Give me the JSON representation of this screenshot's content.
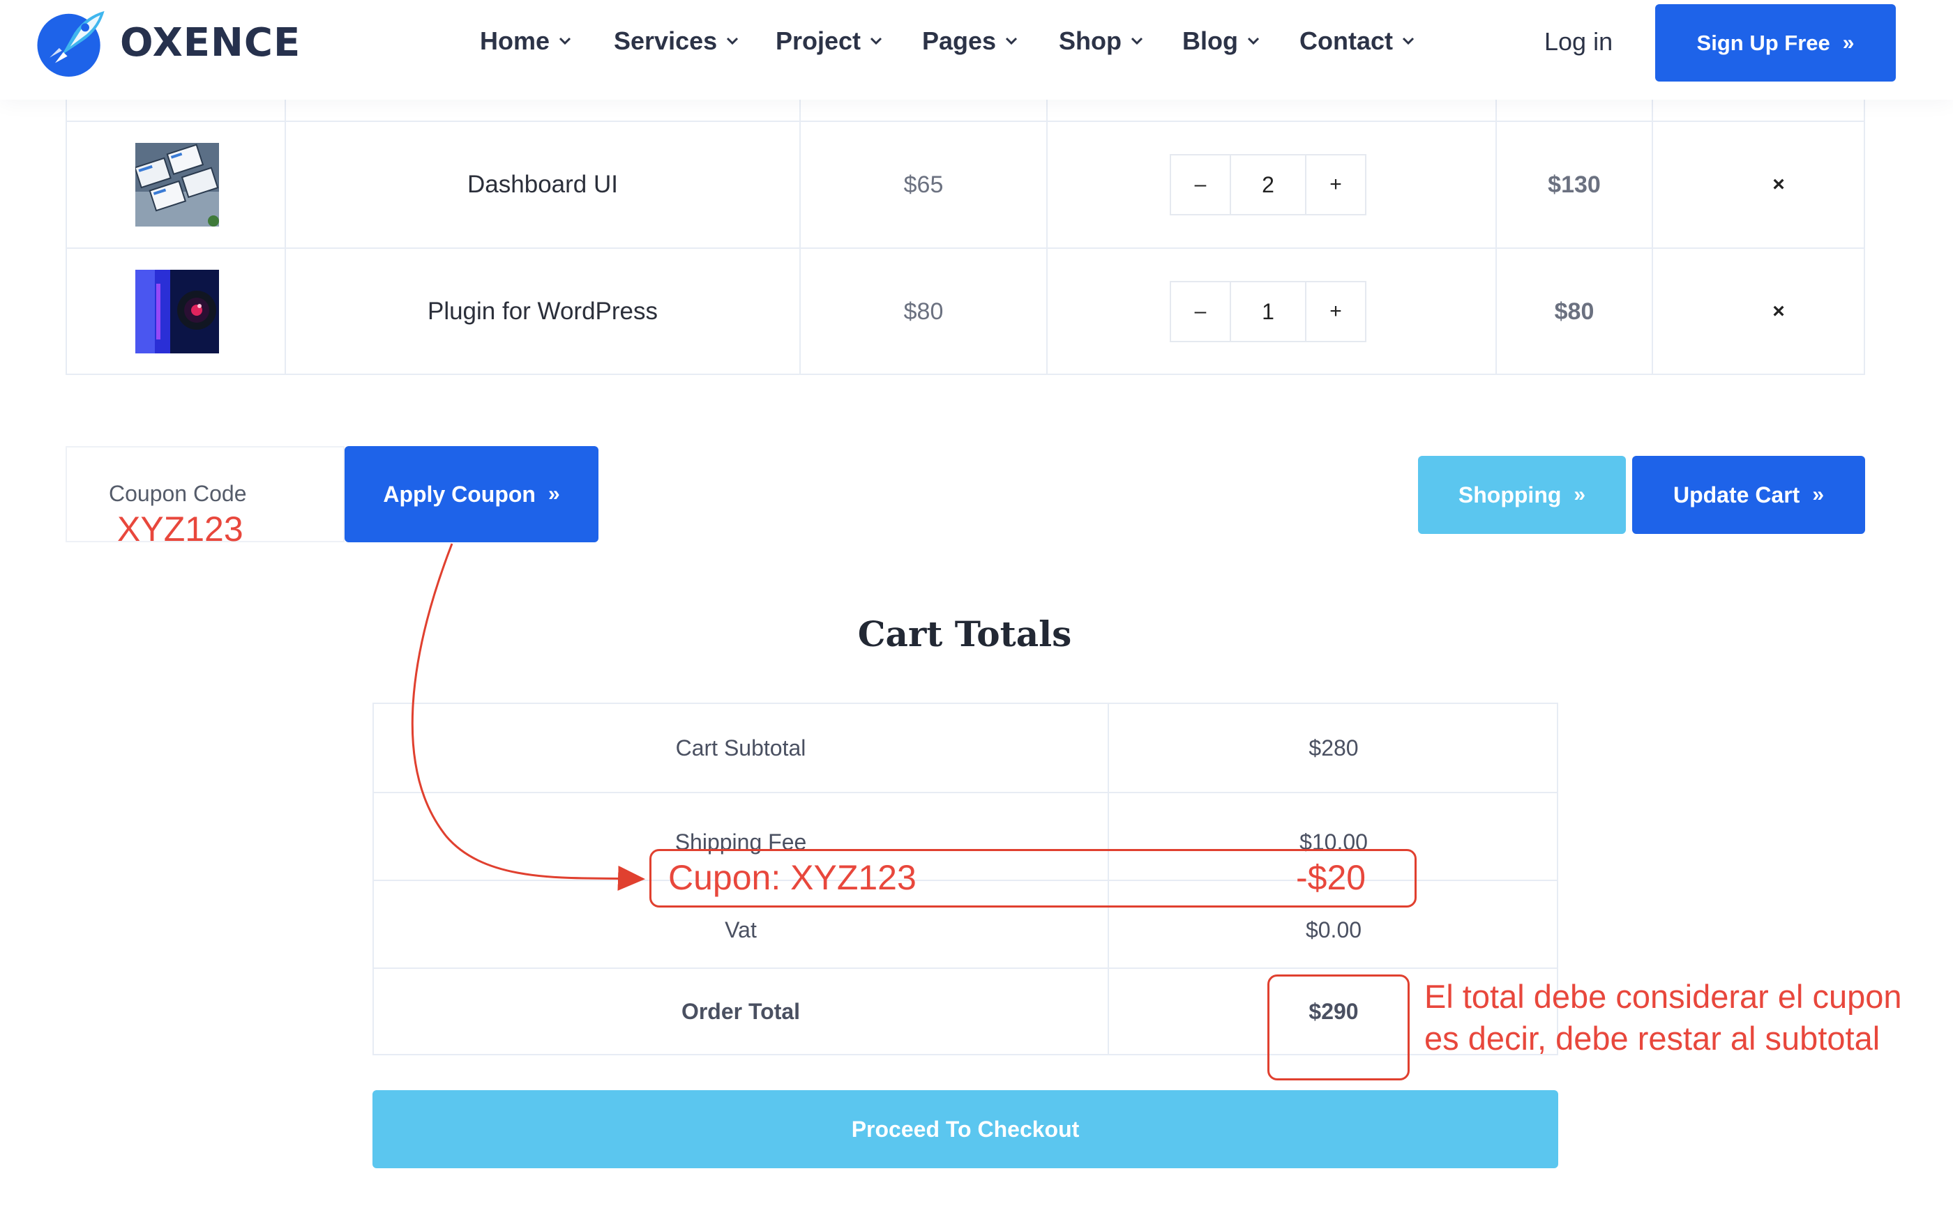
{
  "brand": {
    "name": "OXENCE"
  },
  "nav": {
    "items": [
      {
        "label": "Home"
      },
      {
        "label": "Services"
      },
      {
        "label": "Project"
      },
      {
        "label": "Pages"
      },
      {
        "label": "Shop"
      },
      {
        "label": "Blog"
      },
      {
        "label": "Contact"
      }
    ],
    "login_label": "Log in",
    "signup_label": "Sign Up Free",
    "signup_icon": "double-chevron-right-icon"
  },
  "cart": {
    "rows": [
      {
        "product": "Dashboard UI",
        "price": "$65",
        "quantity": "2",
        "subtotal": "$130",
        "remove": "×",
        "thumb": "dashboard-thumbnail"
      },
      {
        "product": "Plugin for WordPress",
        "price": "$80",
        "quantity": "1",
        "subtotal": "$80",
        "remove": "×",
        "thumb": "plugin-thumbnail"
      }
    ],
    "minus_label": "–",
    "plus_label": "+"
  },
  "coupon": {
    "placeholder": "Coupon Code",
    "handwritten_value": "XYZ123",
    "apply_label": "Apply Coupon"
  },
  "actions": {
    "shopping_label": "Shopping",
    "update_label": "Update Cart"
  },
  "totals": {
    "title": "Cart Totals",
    "rows": [
      {
        "label": "Cart Subtotal",
        "value": "$280"
      },
      {
        "label": "Shipping Fee",
        "value": "$10.00"
      },
      {
        "label": "Vat",
        "value": "$0.00"
      },
      {
        "label": "Order Total",
        "value": "$290"
      }
    ],
    "checkout_label": "Proceed To Checkout"
  },
  "annotations": {
    "coupon_line_label": "Cupon: XYZ123",
    "coupon_line_value": "-$20",
    "note_line1": "El total debe considerar el cupon",
    "note_line2": "es decir, debe restar al subtotal",
    "color": "#e8473c"
  },
  "colors": {
    "primary": "#1e63e9",
    "light_blue": "#5bc6ef",
    "brand_text": "#26314d",
    "annotation": "#e8473c"
  }
}
